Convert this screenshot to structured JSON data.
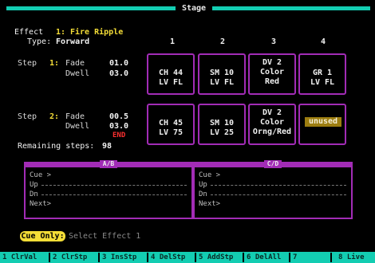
{
  "title": "Stage",
  "effect": {
    "label": "Effect",
    "number": "1:",
    "name": "Fire Ripple",
    "type_label": "Type:",
    "type_value": "Forward"
  },
  "columns": [
    "1",
    "2",
    "3",
    "4"
  ],
  "steps": [
    {
      "label": "Step",
      "number": "1:",
      "fade_label": "Fade",
      "fade_value": "01.0",
      "dwell_label": "Dwell",
      "dwell_value": "03.0",
      "cells": [
        {
          "l1": "CH  44",
          "l2": "LV  FL"
        },
        {
          "l1": "SM  10",
          "l2": "LV  FL"
        },
        {
          "l1": "DV   2",
          "l2": "Color",
          "l3": "Red"
        },
        {
          "l1": "GR   1",
          "l2": "LV  FL"
        }
      ]
    },
    {
      "label": "Step",
      "number": "2:",
      "fade_label": "Fade",
      "fade_value": "00.5",
      "dwell_label": "Dwell",
      "dwell_value": "03.0",
      "end_label": "END",
      "cells": [
        {
          "l1": "CH  45",
          "l2": "LV  75"
        },
        {
          "l1": "SM  10",
          "l2": "LV  25"
        },
        {
          "l1": "DV   2",
          "l2": "Color",
          "l3": "Orng/Red"
        },
        {
          "unused": "unused"
        }
      ]
    }
  ],
  "remaining": {
    "label": "Remaining steps:",
    "value": "98"
  },
  "panels": [
    {
      "title": "A/B",
      "cue": "Cue >",
      "up": "Up",
      "dn": "Dn",
      "next": "Next>"
    },
    {
      "title": "C/D",
      "cue": "Cue >",
      "up": "Up",
      "dn": "Dn",
      "next": "Next>"
    }
  ],
  "status": {
    "mode": "Cue Only:",
    "prompt": "Select Effect 1"
  },
  "function_keys": [
    {
      "num": "1",
      "label": "ClrVal"
    },
    {
      "num": "2",
      "label": "ClrStp"
    },
    {
      "num": "3",
      "label": "InsStp"
    },
    {
      "num": "4",
      "label": "DelStp"
    },
    {
      "num": "5",
      "label": "AddStp"
    },
    {
      "num": "6",
      "label": "DelAll"
    },
    {
      "num": "7",
      "label": ""
    },
    {
      "num": "8",
      "label": "Live"
    }
  ],
  "colors": {
    "accent": "#13cdb2",
    "border": "#a22cb6",
    "highlight": "#f4dd37",
    "end": "#ff3030"
  }
}
